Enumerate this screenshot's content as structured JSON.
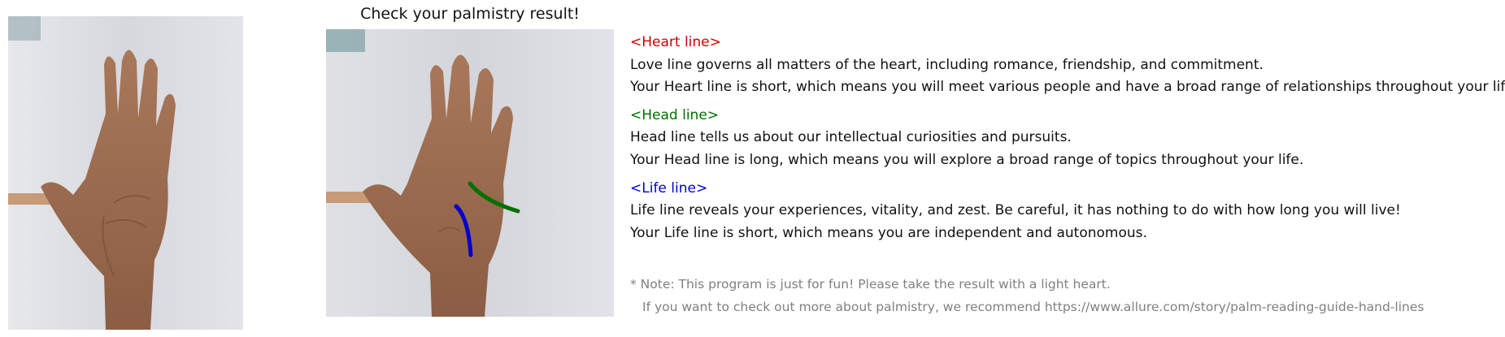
{
  "result_title": "Check your palmistry result!",
  "images": {
    "left": {
      "icon": "palm-photo-icon"
    },
    "right": {
      "icon": "palm-photo-annotated-icon"
    }
  },
  "colors": {
    "heart_line": "#d00000",
    "head_line": "#007000",
    "life_line": "#0000cc",
    "note_text": "#808080"
  },
  "heart": {
    "title": "<Heart line>",
    "desc": "Love line governs all matters of the heart, including romance, friendship, and commitment.",
    "result": "Your Heart line is short, which means you will meet various people and have a broad range of relationships throughout your life."
  },
  "head": {
    "title": "<Head line>",
    "desc": "Head line tells us about our intellectual curiosities and pursuits.",
    "result": "Your Head line is long, which means you will explore a broad range of topics throughout your life."
  },
  "life": {
    "title": "<Life line>",
    "desc": "Life line reveals your experiences, vitality, and zest. Be careful, it has nothing to do with how long you will live!",
    "result": "Your Life line is short, which means you are independent and autonomous."
  },
  "note": {
    "line1": "* Note: This program is just for fun! Please take the result with a light heart.",
    "line2": "If you want to check out more about palmistry, we recommend https://www.allure.com/story/palm-reading-guide-hand-lines"
  }
}
